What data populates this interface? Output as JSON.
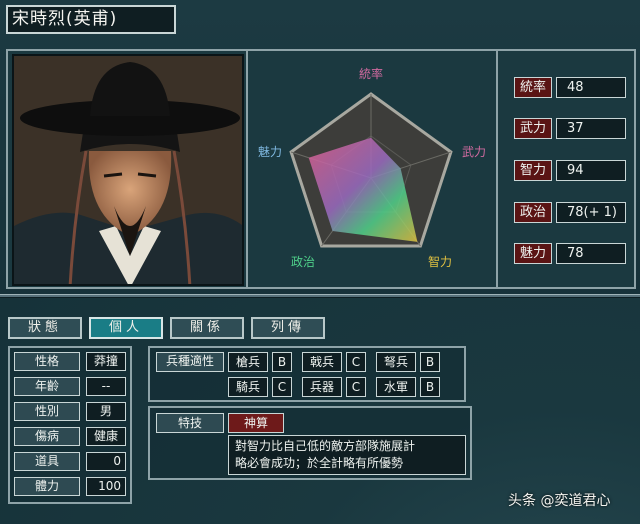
{
  "officer": {
    "name": "宋時烈(英甫)"
  },
  "radar": {
    "labels": {
      "lead": "統率",
      "war": "武力",
      "int": "智力",
      "pol": "政治",
      "cha": "魅力"
    }
  },
  "stats": [
    {
      "label": "統率",
      "value": "48"
    },
    {
      "label": "武力",
      "value": "37"
    },
    {
      "label": "智力",
      "value": "94"
    },
    {
      "label": "政治",
      "value": "78(+ 1)"
    },
    {
      "label": "魅力",
      "value": "78"
    }
  ],
  "stat_values": {
    "lead": 48,
    "war": 37,
    "int": 94,
    "pol": 78,
    "cha": 78
  },
  "tabs": [
    "狀態",
    "個人",
    "關係",
    "列傳"
  ],
  "personal": [
    {
      "label": "性格",
      "value": "莽撞"
    },
    {
      "label": "年齡",
      "value": "--"
    },
    {
      "label": "性別",
      "value": "男"
    },
    {
      "label": "傷病",
      "value": "健康"
    },
    {
      "label": "道具",
      "value": "0"
    },
    {
      "label": "體力",
      "value": "100"
    }
  ],
  "aptitude": {
    "title": "兵種適性",
    "units": [
      {
        "name": "槍兵",
        "grade": "B"
      },
      {
        "name": "戟兵",
        "grade": "C"
      },
      {
        "name": "弩兵",
        "grade": "B"
      },
      {
        "name": "騎兵",
        "grade": "C"
      },
      {
        "name": "兵器",
        "grade": "C"
      },
      {
        "name": "水軍",
        "grade": "B"
      }
    ]
  },
  "skill": {
    "title": "特技",
    "name": "神算",
    "desc_line1": "對智力比自己低的敵方部隊施展計",
    "desc_line2": "略必會成功；於全計略有所優勢"
  },
  "watermark": "头条 @奕道君心",
  "colors": {
    "accent": "#1a7d86",
    "stat_label_bg": "#5a1414",
    "lead": "#d06aa0",
    "war": "#d06aa0",
    "int": "#e0c040",
    "pol": "#4fd08a",
    "cha": "#7fb8e0"
  }
}
